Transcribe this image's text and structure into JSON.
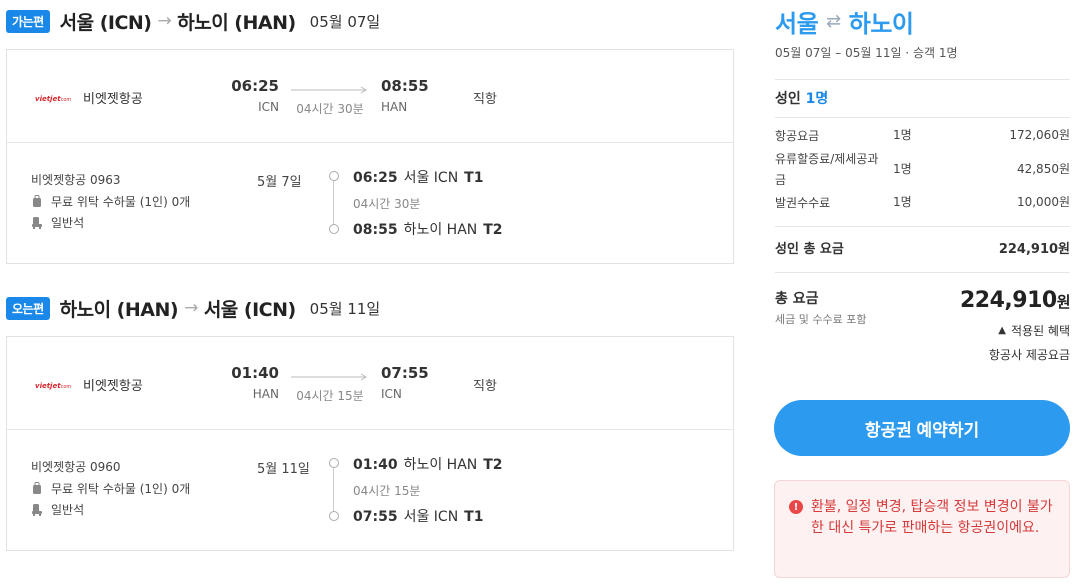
{
  "outbound": {
    "badge": "가는편",
    "from": "서울 (ICN)",
    "to": "하노이 (HAN)",
    "date": "05월 07일",
    "airline": "비엣젯항공",
    "dep_time": "06:25",
    "dep_code": "ICN",
    "arr_time": "08:55",
    "arr_code": "HAN",
    "duration": "04시간 30분",
    "direct": "직항",
    "flight_no": "비엣젯항공 0963",
    "baggage": "무료 위탁 수하물 (1인) 0개",
    "cabin": "일반석",
    "short_date": "5월 7일",
    "seg_dep_time": "06:25",
    "seg_dep_place": "서울 ICN",
    "seg_dep_term": "T1",
    "seg_duration": "04시간 30분",
    "seg_arr_time": "08:55",
    "seg_arr_place": "하노이 HAN",
    "seg_arr_term": "T2"
  },
  "inbound": {
    "badge": "오는편",
    "from": "하노이 (HAN)",
    "to": "서울 (ICN)",
    "date": "05월 11일",
    "airline": "비엣젯항공",
    "dep_time": "01:40",
    "dep_code": "HAN",
    "arr_time": "07:55",
    "arr_code": "ICN",
    "duration": "04시간 15분",
    "direct": "직항",
    "flight_no": "비엣젯항공 0960",
    "baggage": "무료 위탁 수하물 (1인) 0개",
    "cabin": "일반석",
    "short_date": "5월 11일",
    "seg_dep_time": "01:40",
    "seg_dep_place": "하노이 HAN",
    "seg_dep_term": "T2",
    "seg_duration": "04시간 15분",
    "seg_arr_time": "07:55",
    "seg_arr_place": "서울 ICN",
    "seg_arr_term": "T1"
  },
  "summary": {
    "from": "서울",
    "to": "하노이",
    "subtitle": "05월 07일 – 05월 11일 · 승객 1명",
    "adult_label": "성인",
    "adult_count": "1명",
    "fees": [
      {
        "label": "항공요금",
        "qty": "1명",
        "amount": "172,060원"
      },
      {
        "label": "유류할증료/제세공과금",
        "qty": "1명",
        "amount": "42,850원"
      },
      {
        "label": "발권수수료",
        "qty": "1명",
        "amount": "10,000원"
      }
    ],
    "adult_total_label": "성인 총 요금",
    "adult_total": "224,910원",
    "total_label": "총 요금",
    "total_note": "세금 및 수수료 포함",
    "total_amount": "224,910",
    "total_unit": "원",
    "applied_label": "적용된 혜택",
    "airline_fare": "항공사 제공요금",
    "book_button": "항공권 예약하기",
    "notice": "환불, 일정 변경, 탑승객 정보 변경이 불가한 대신 특가로 판매하는 항공권이에요."
  },
  "colors": {
    "accent": "#2c9aef",
    "badge": "#1a88e8",
    "notice_text": "#d63a3a",
    "notice_bg": "#fdf1f1",
    "airline_logo": "#d6262b"
  }
}
